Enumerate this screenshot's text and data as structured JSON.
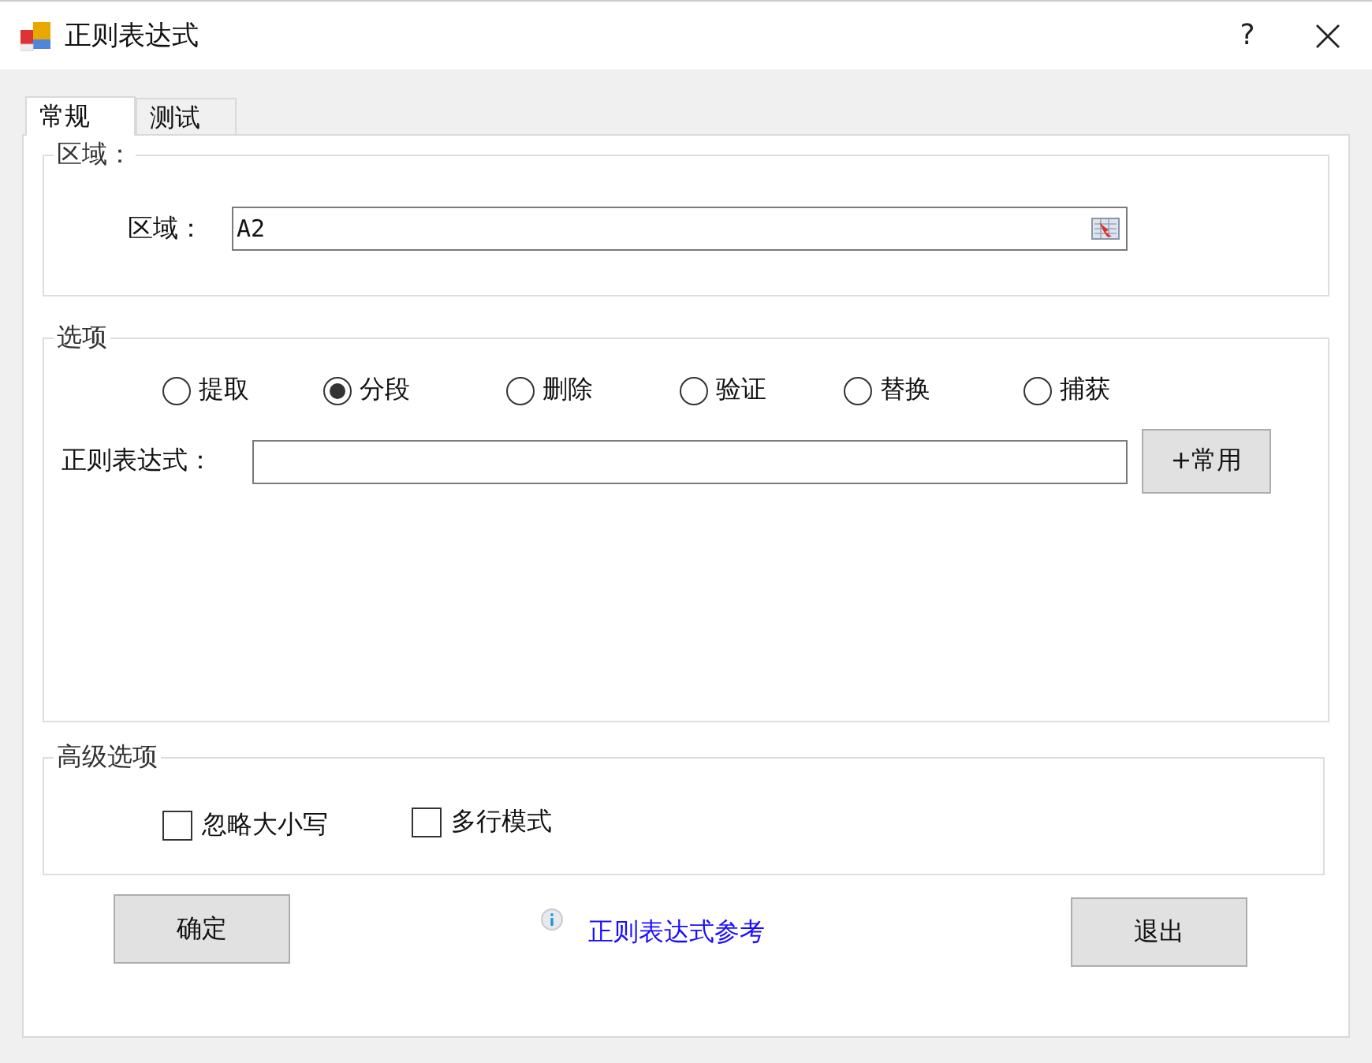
{
  "window": {
    "title": "正则表达式",
    "help": "?"
  },
  "tabs": [
    {
      "label": "常规",
      "selected": true
    },
    {
      "label": "测试",
      "selected": false
    }
  ],
  "range_group": {
    "title": "区域：",
    "field_label": "区域：",
    "value": "A2"
  },
  "options_group": {
    "title": "选项",
    "modes": [
      {
        "label": "提取",
        "selected": false
      },
      {
        "label": "分段",
        "selected": true
      },
      {
        "label": "删除",
        "selected": false
      },
      {
        "label": "验证",
        "selected": false
      },
      {
        "label": "替换",
        "selected": false
      },
      {
        "label": "捕获",
        "selected": false
      }
    ],
    "regex_label": "正则表达式：",
    "common_button": "+常用"
  },
  "advanced_group": {
    "title": "高级选项",
    "checkboxes": [
      {
        "label": "忽略大小写",
        "checked": false
      },
      {
        "label": "多行模式",
        "checked": false
      }
    ]
  },
  "ok_button": "确定",
  "reference_link": "正则表达式参考",
  "exit_button": "退出"
}
